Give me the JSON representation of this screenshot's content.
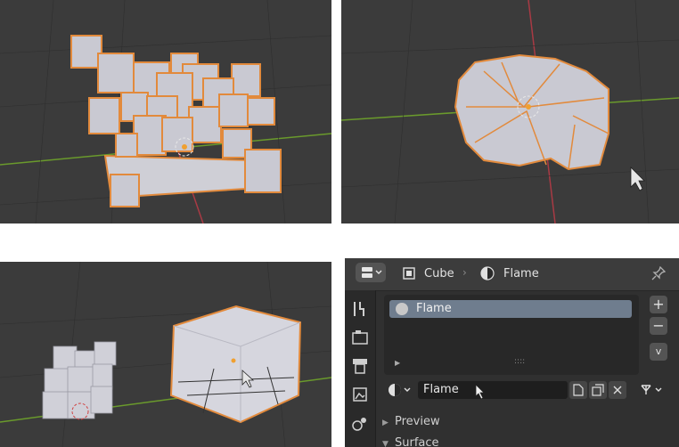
{
  "properties": {
    "breadcrumb": {
      "object_name": "Cube",
      "material_name": "Flame"
    },
    "material_slots": [
      "Flame"
    ],
    "list_buttons": {
      "add": "+",
      "remove": "−",
      "specials": "v"
    },
    "list_grip": "::::",
    "material_field": {
      "value": "Flame"
    },
    "sections": {
      "preview": "Preview",
      "surface": "Surface"
    }
  },
  "colors": {
    "viewport_bg": "#3b3b3b",
    "selection_outline": "#e28a3c",
    "active_item": "#6f7d8e",
    "x_axis": "#a83a44",
    "y_axis": "#6a9a2c"
  }
}
